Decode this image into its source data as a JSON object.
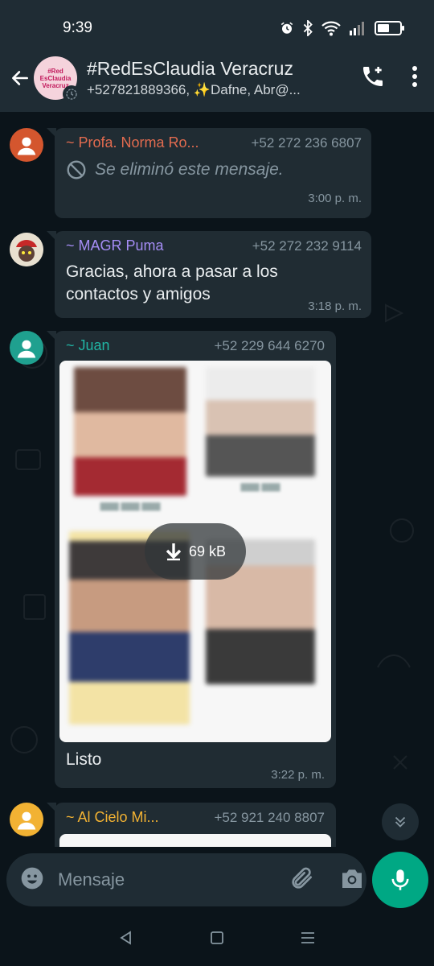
{
  "status_bar": {
    "time": "9:39"
  },
  "header": {
    "title": "#RedEsClaudia Veracruz",
    "members": "+527821889366, ✨Dafne, Abr@...",
    "avatar_text": "#Red EsClaudia Veracruz"
  },
  "messages": [
    {
      "sender": "~ Profa. Norma Ro...",
      "sender_color": "#e26b4f",
      "phone": "+52 272 236 6807",
      "deleted_text": "Se eliminó este mensaje.",
      "time": "3:00 p. m."
    },
    {
      "sender": "~ MAGR Puma",
      "sender_color": "#a58df5",
      "phone": "+52 272 232 9114",
      "text": "Gracias, ahora a pasar a los contactos y amigos",
      "time": "3:18 p. m."
    },
    {
      "sender": "~ Juan",
      "sender_color": "#21b5a4",
      "phone": "+52 229 644 6270",
      "image_size": "69 kB",
      "caption": "Listo",
      "time": "3:22 p. m."
    },
    {
      "sender": "~ Al Cielo Mi...",
      "sender_color": "#f2b233",
      "phone": "+52 921 240 8807"
    }
  ],
  "input": {
    "placeholder": "Mensaje"
  },
  "colors": {
    "accent": "#00a884",
    "bubble": "#202c33",
    "header": "#1f2c34",
    "background": "#0b141a"
  }
}
